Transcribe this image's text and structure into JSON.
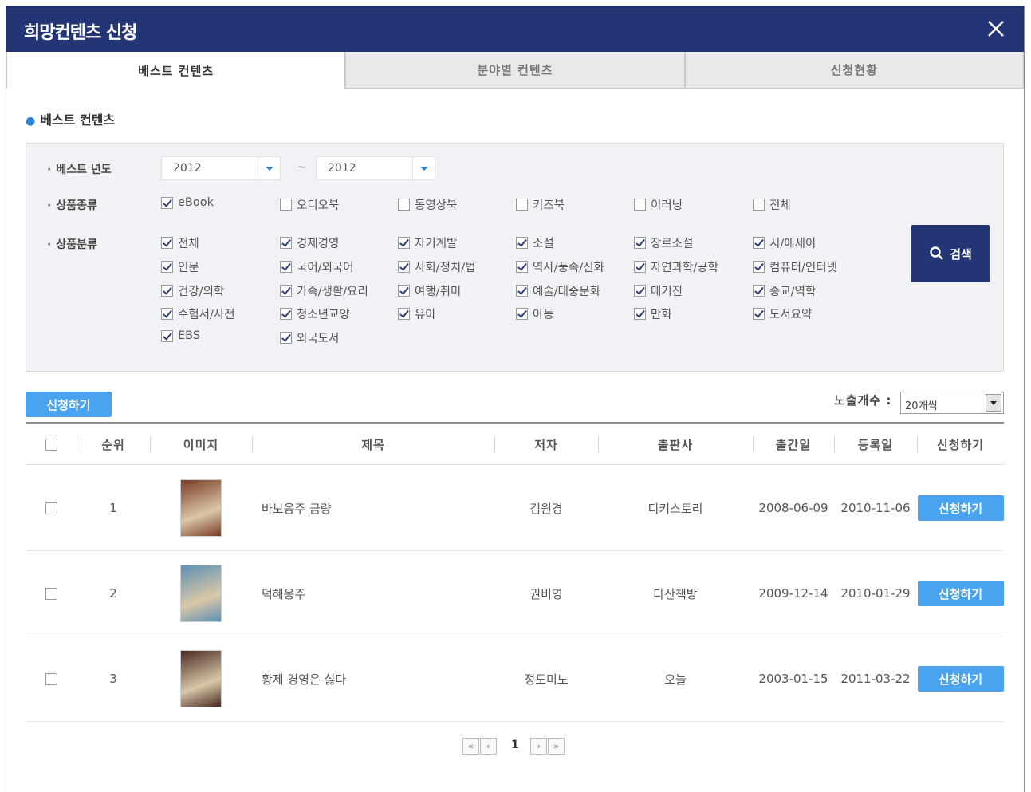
{
  "dialog": {
    "title": "희망컨텐츠 신청"
  },
  "tabs": [
    {
      "label": "베스트 컨텐츠",
      "active": true
    },
    {
      "label": "분야별 컨텐츠",
      "active": false
    },
    {
      "label": "신청현황",
      "active": false
    }
  ],
  "section": {
    "title": "베스트 컨텐츠"
  },
  "filter": {
    "year_label": "베스트 년도",
    "year_from": "2012",
    "year_sep": "~",
    "year_to": "2012",
    "type_label": "상품종류",
    "types": [
      {
        "label": "eBook",
        "checked": true
      },
      {
        "label": "오디오북",
        "checked": false
      },
      {
        "label": "동영상북",
        "checked": false
      },
      {
        "label": "키즈북",
        "checked": false
      },
      {
        "label": "이러닝",
        "checked": false
      },
      {
        "label": "전체",
        "checked": false
      }
    ],
    "category_label": "상품분류",
    "categories": [
      {
        "label": "전체",
        "checked": true
      },
      {
        "label": "경제경영",
        "checked": true
      },
      {
        "label": "자기계발",
        "checked": true
      },
      {
        "label": "소설",
        "checked": true
      },
      {
        "label": "장르소설",
        "checked": true
      },
      {
        "label": "시/에세이",
        "checked": true
      },
      {
        "label": "인문",
        "checked": true
      },
      {
        "label": "국어/외국어",
        "checked": true
      },
      {
        "label": "사회/정치/법",
        "checked": true
      },
      {
        "label": "역사/풍속/신화",
        "checked": true
      },
      {
        "label": "자연과학/공학",
        "checked": true
      },
      {
        "label": "컴퓨터/인터넷",
        "checked": true
      },
      {
        "label": "건강/의학",
        "checked": true
      },
      {
        "label": "가족/생활/요리",
        "checked": true
      },
      {
        "label": "여행/취미",
        "checked": true
      },
      {
        "label": "예술/대중문화",
        "checked": true
      },
      {
        "label": "매거진",
        "checked": true
      },
      {
        "label": "종교/역학",
        "checked": true
      },
      {
        "label": "수험서/사전",
        "checked": true
      },
      {
        "label": "청소년교양",
        "checked": true
      },
      {
        "label": "유아",
        "checked": true
      },
      {
        "label": "아동",
        "checked": true
      },
      {
        "label": "만화",
        "checked": true
      },
      {
        "label": "도서요약",
        "checked": true
      },
      {
        "label": "EBS",
        "checked": true
      },
      {
        "label": "외국도서",
        "checked": true
      }
    ],
    "search_label": "검색"
  },
  "toolbar": {
    "apply_label": "신청하기",
    "count_label": "노출개수 :",
    "count_value": "20개씩"
  },
  "table": {
    "headers": [
      "순위",
      "이미지",
      "제목",
      "저자",
      "출판사",
      "출간일",
      "등록일",
      "신청하기"
    ],
    "rows": [
      {
        "rank": "1",
        "title": "바보옹주 금량",
        "author": "김원경",
        "publisher": "디키스토리",
        "published": "2008-06-09",
        "registered": "2010-11-06",
        "action": "신청하기",
        "cover_color": "#7a3b24"
      },
      {
        "rank": "2",
        "title": "덕혜옹주",
        "author": "권비영",
        "publisher": "다산책방",
        "published": "2009-12-14",
        "registered": "2010-01-29",
        "action": "신청하기",
        "cover_color": "#5e8fb5"
      },
      {
        "rank": "3",
        "title": "황제 경영은 싫다",
        "author": "정도미노",
        "publisher": "오늘",
        "published": "2003-01-15",
        "registered": "2011-03-22",
        "action": "신청하기",
        "cover_color": "#4a2a22"
      }
    ]
  },
  "pager": {
    "current": "1",
    "first": "«",
    "prev": "‹",
    "next": "›",
    "last": "»"
  },
  "colors": {
    "header": "#243576",
    "accent": "#4aa3ef",
    "panel": "#f1f2f5"
  }
}
